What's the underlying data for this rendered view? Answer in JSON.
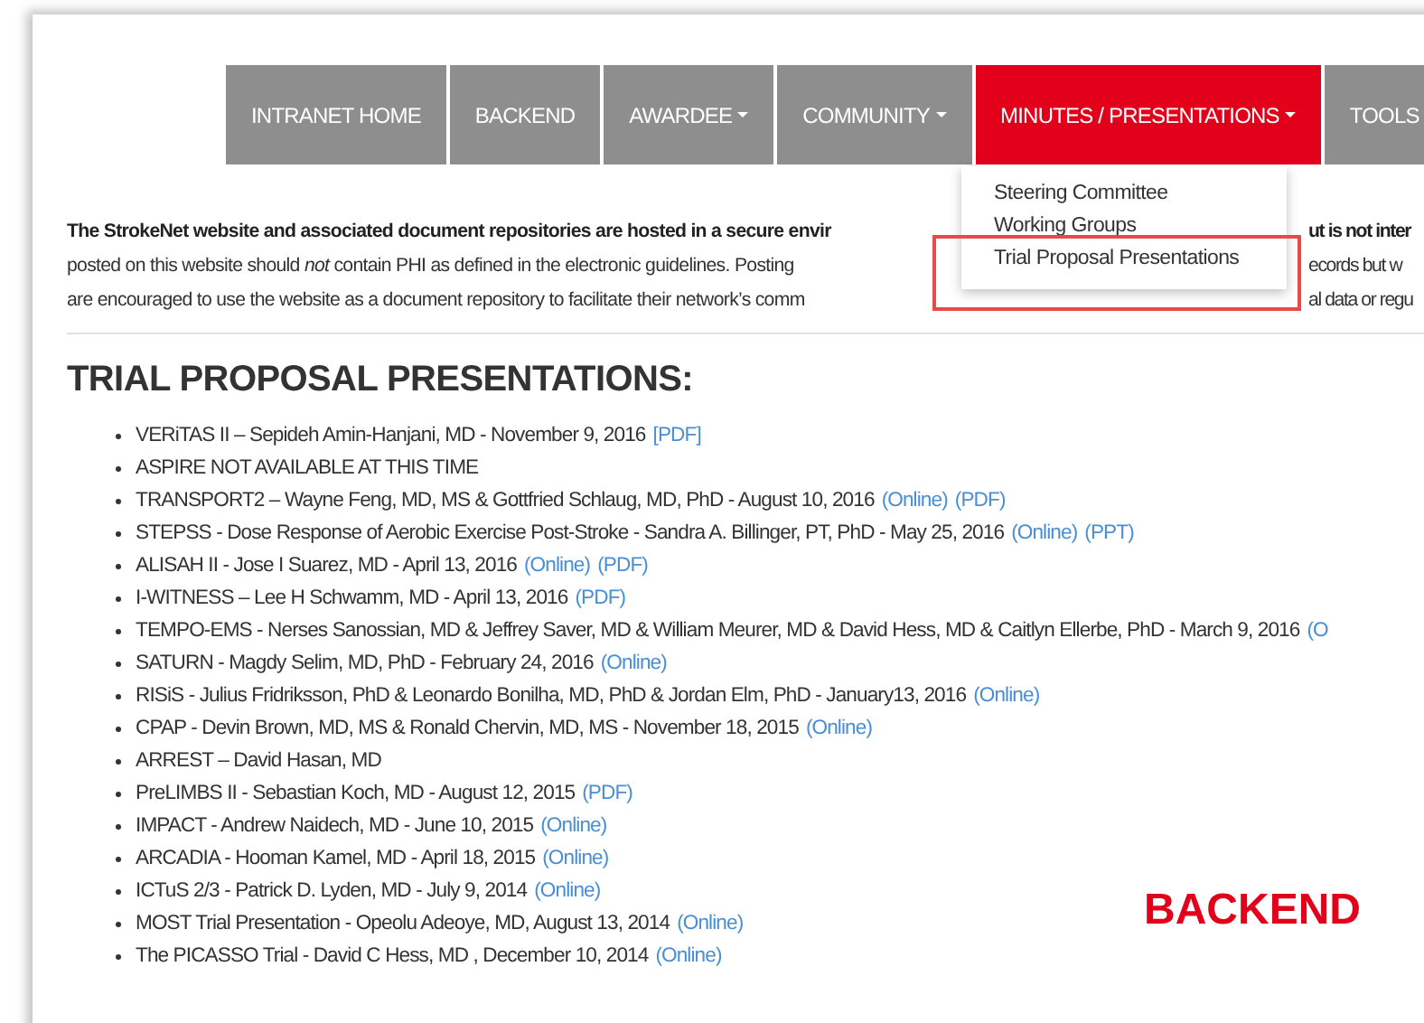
{
  "nav": {
    "items": [
      {
        "label": "INTRANET HOME",
        "dropdown": false,
        "selected": false
      },
      {
        "label": "BACKEND",
        "dropdown": false,
        "selected": false
      },
      {
        "label": "AWARDEE",
        "dropdown": true,
        "selected": false
      },
      {
        "label": "COMMUNITY",
        "dropdown": true,
        "selected": false
      },
      {
        "label": "MINUTES / PRESENTATIONS",
        "dropdown": true,
        "selected": true
      },
      {
        "label": "TOOLS",
        "dropdown": false,
        "selected": false
      }
    ],
    "menu": {
      "items": [
        {
          "label": "Steering Committee",
          "highlighted": false
        },
        {
          "label": "Working Groups",
          "highlighted": false
        },
        {
          "label": "Trial Proposal Presentations",
          "highlighted": true
        }
      ]
    }
  },
  "intro": [
    {
      "left": "The StrokeNet website and associated document repositories are hosted in a secure envir",
      "right": "ut is not inter",
      "bold": true
    },
    {
      "left": "posted on this website should *not* contain PHI as defined in the electronic guidelines. Posting",
      "right": "ecords but w",
      "bold": false
    },
    {
      "left": "are encouraged to use the website as a document repository to facilitate their network’s comm",
      "right": "al data or regu",
      "bold": false
    }
  ],
  "heading": "TRIAL PROPOSAL PRESENTATIONS:",
  "items": [
    {
      "text": "VERiTAS II – Sepideh Amin-Hanjani, MD - November 9, 2016",
      "links": [
        "[PDF]"
      ]
    },
    {
      "text": "ASPIRE NOT AVAILABLE AT THIS TIME"
    },
    {
      "text": "TRANSPORT2 – Wayne Feng, MD, MS & Gottfried Schlaug, MD, PhD - August 10, 2016",
      "links": [
        "(Online)",
        "(PDF)"
      ]
    },
    {
      "text": "STEPSS - Dose Response of Aerobic Exercise Post-Stroke - Sandra A. Billinger, PT, PhD - May 25, 2016",
      "links": [
        "(Online)",
        "(PPT)"
      ]
    },
    {
      "text": "ALISAH II - Jose I Suarez, MD - April 13, 2016",
      "links": [
        "(Online)",
        "(PDF)"
      ]
    },
    {
      "text": "I-WITNESS – Lee H Schwamm, MD - April 13, 2016",
      "links": [
        "(PDF)"
      ]
    },
    {
      "text": "TEMPO-EMS - Nerses Sanossian, MD & Jeffrey Saver, MD & William Meurer, MD & David Hess, MD & Caitlyn Ellerbe, PhD - March 9, 2016",
      "links": [
        "(O"
      ]
    },
    {
      "text": "SATURN - Magdy Selim, MD, PhD - February 24, 2016",
      "links": [
        "(Online)"
      ]
    },
    {
      "text": "RISiS - Julius Fridriksson, PhD & Leonardo Bonilha, MD, PhD & Jordan Elm, PhD - January13, 2016",
      "links": [
        "(Online)"
      ]
    },
    {
      "text": "CPAP - Devin Brown, MD, MS & Ronald Chervin, MD, MS - November 18, 2015",
      "links": [
        "(Online)"
      ]
    },
    {
      "text": "ARREST – David Hasan, MD"
    },
    {
      "text": "PreLIMBS II - Sebastian Koch, MD - August 12, 2015",
      "links": [
        "(PDF)"
      ]
    },
    {
      "text": "IMPACT - Andrew Naidech, MD - June 10, 2015",
      "links": [
        "(Online)"
      ]
    },
    {
      "text": "ARCADIA - Hooman Kamel, MD - April 18, 2015",
      "links": [
        "(Online)"
      ]
    },
    {
      "text": "ICTuS 2/3 - Patrick D. Lyden, MD - July 9, 2014",
      "links": [
        "(Online)"
      ]
    },
    {
      "text": "MOST Trial Presentation - Opeolu Adeoye, MD, August 13, 2014",
      "links": [
        "(Online)"
      ]
    },
    {
      "text": "The PICASSO Trial - David C Hess, MD , December 10, 2014",
      "links": [
        "(Online)"
      ]
    }
  ],
  "annotation_label": "BACKEND"
}
